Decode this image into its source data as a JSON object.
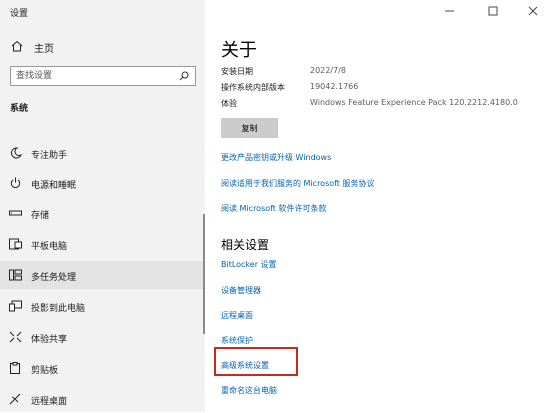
{
  "window": {
    "title": "设置",
    "controls": [
      "minimize",
      "maximize",
      "close"
    ]
  },
  "sidebar": {
    "home_label": "主页",
    "search": {
      "placeholder": "查找设置"
    },
    "section_title": "系统",
    "items": [
      {
        "label": "专注助手",
        "icon": "moon-icon"
      },
      {
        "label": "电源和睡眠",
        "icon": "power-icon"
      },
      {
        "label": "存储",
        "icon": "storage-icon"
      },
      {
        "label": "平板电脑",
        "icon": "tablet-icon"
      },
      {
        "label": "多任务处理",
        "icon": "multitasking-icon",
        "selected": true
      },
      {
        "label": "投影到此电脑",
        "icon": "projector-icon"
      },
      {
        "label": "体验共享",
        "icon": "share-icon"
      },
      {
        "label": "剪贴板",
        "icon": "clipboard-icon"
      },
      {
        "label": "远程桌面",
        "icon": "remote-desktop-icon"
      }
    ]
  },
  "main": {
    "title": "关于",
    "specs": [
      {
        "label": "安装日期",
        "value": "2022/7/8"
      },
      {
        "label": "操作系统内部版本",
        "value": "19042.1766"
      },
      {
        "label": "体验",
        "value": "Windows Feature Experience Pack 120.2212.4180.0"
      }
    ],
    "copy_button": "复制",
    "links": [
      "更改产品密钥或升级 Windows",
      "阅读适用于我们服务的 Microsoft 服务协议",
      "阅读 Microsoft 软件许可条款"
    ],
    "related_title": "相关设置",
    "related_links": [
      "BitLocker 设置",
      "设备管理器",
      "远程桌面",
      "系统保护",
      "高级系统设置",
      "重命名这台电脑"
    ]
  },
  "colors": {
    "link": "#0063b1",
    "highlight": "#c42b1c",
    "sidebar_bg": "#f2f2f2",
    "selected_bg": "#e3e3e3"
  }
}
